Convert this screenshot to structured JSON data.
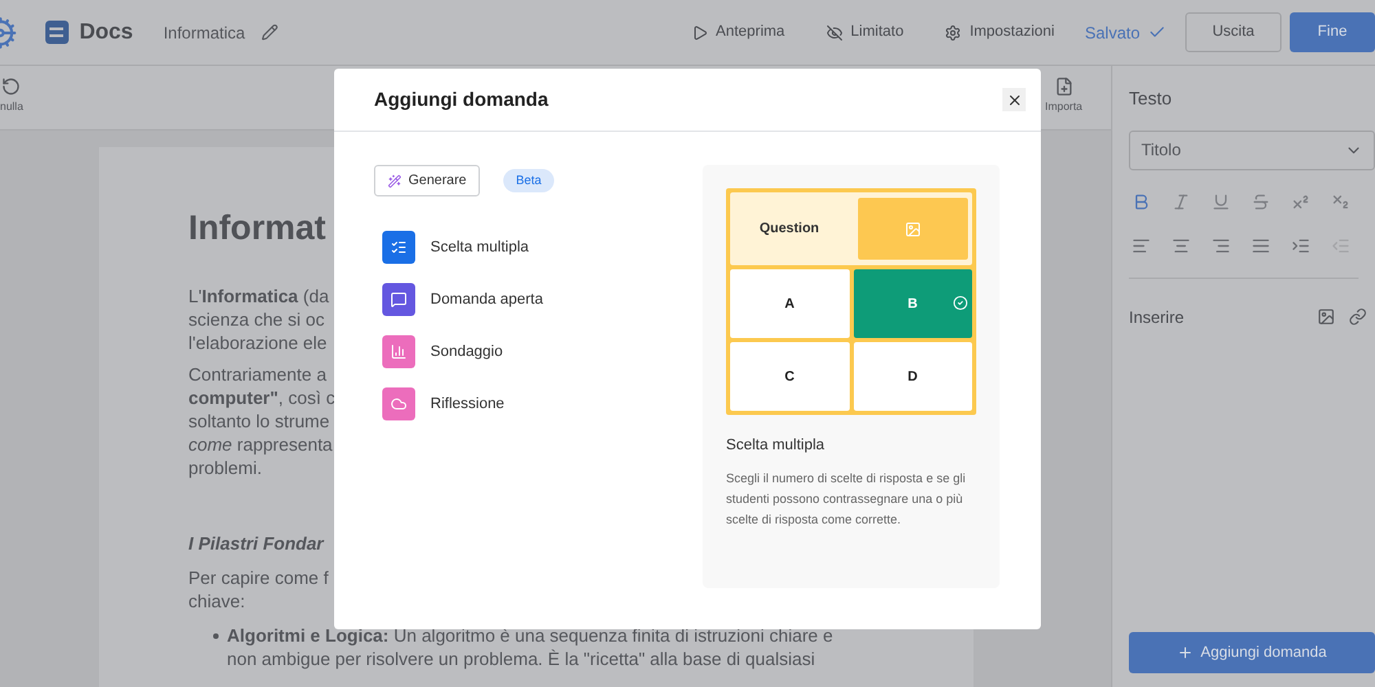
{
  "topbar": {
    "title": "Docs",
    "document_name": "Informatica",
    "actions": [
      {
        "label": "Anteprima",
        "kind": "play"
      },
      {
        "label": "Limitato",
        "kind": "eye-off"
      },
      {
        "label": "Impostazioni",
        "kind": "gear"
      }
    ],
    "save_status": "Salvato",
    "buttons": [
      {
        "label": "Uscita",
        "kind": "outline"
      },
      {
        "label": "Fine",
        "kind": "primary"
      }
    ]
  },
  "toolbar": [
    {
      "label": "nulla",
      "kind": "undo"
    },
    {
      "label": "Importa",
      "kind": "import"
    }
  ],
  "document": {
    "title": "Informat",
    "paragraphs": [
      [
        "L'**Informatica** (da",
        "scienza che si oc",
        "l'elaborazione ele"
      ],
      [
        "Contrariamente a",
        "**computer\"**, così c",
        "soltanto lo strume",
        "*come* rappresenta",
        "problemi."
      ]
    ],
    "heading": "I Pilastri Fondar",
    "intro": [
      "Per capire come f",
      "chiave:"
    ],
    "bullets": [
      [
        "**Algoritmi e Logica:** Un algoritmo è una sequenza finita di istruzioni chiare e",
        "non ambigue per risolvere un problema. È la \"ricetta\" alla base di qualsiasi"
      ]
    ]
  },
  "sidebar": {
    "section": "Testo",
    "style_select": "Titolo",
    "format_tools": [
      {
        "kind": "bold",
        "selected": true
      },
      {
        "kind": "italic",
        "selected": false
      },
      {
        "kind": "underline",
        "selected": false
      },
      {
        "kind": "strike",
        "selected": false
      },
      {
        "kind": "superscript",
        "selected": false
      },
      {
        "kind": "subscript",
        "selected": false
      }
    ],
    "align_tools": [
      {
        "kind": "left",
        "disabled": false
      },
      {
        "kind": "center",
        "disabled": false
      },
      {
        "kind": "right",
        "disabled": false
      },
      {
        "kind": "justify",
        "disabled": false
      },
      {
        "kind": "indent",
        "disabled": false
      },
      {
        "kind": "outdent",
        "disabled": true
      }
    ],
    "insert_label": "Inserire",
    "add_button": "Aggiungi domanda"
  },
  "modal": {
    "title": "Aggiungi domanda",
    "generate_button": "Generare",
    "badge": "Beta",
    "question_types": [
      {
        "label": "Scelta multipla",
        "kind": "multiple-choice",
        "color": "#1a6fe6"
      },
      {
        "label": "Domanda aperta",
        "kind": "open",
        "color": "#6457e0"
      },
      {
        "label": "Sondaggio",
        "kind": "poll",
        "color": "#ec6dbc"
      },
      {
        "label": "Riflessione",
        "kind": "reflection",
        "color": "#ec6dbc"
      }
    ],
    "preview": {
      "question": "Question",
      "options": [
        {
          "label": "A",
          "correct": false
        },
        {
          "label": "B",
          "correct": true
        },
        {
          "label": "C",
          "correct": false
        },
        {
          "label": "D",
          "correct": false
        }
      ],
      "title": "Scelta multipla",
      "description": "Scegli il numero di scelte di risposta e se gli studenti possono contrassegnare una o più scelte di risposta come corrette."
    }
  }
}
